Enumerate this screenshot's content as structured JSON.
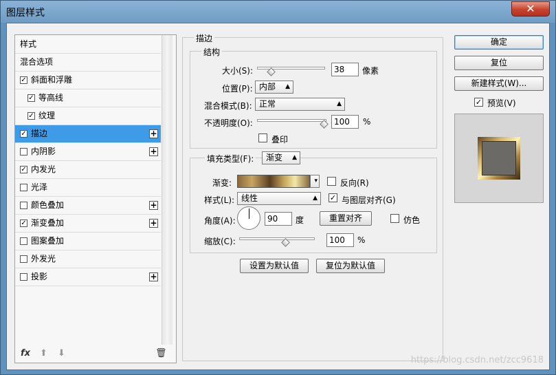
{
  "window": {
    "title": "图层样式",
    "close_glyph": "✕"
  },
  "styles": [
    {
      "label": "样式",
      "check": false,
      "plus": false,
      "indent": 0,
      "sel": false,
      "hascb": false
    },
    {
      "label": "混合选项",
      "check": false,
      "plus": false,
      "indent": 0,
      "sel": false,
      "hascb": false
    },
    {
      "label": "斜面和浮雕",
      "check": true,
      "plus": false,
      "indent": 0,
      "sel": false,
      "hascb": true
    },
    {
      "label": "等高线",
      "check": true,
      "plus": false,
      "indent": 1,
      "sel": false,
      "hascb": true
    },
    {
      "label": "纹理",
      "check": true,
      "plus": false,
      "indent": 1,
      "sel": false,
      "hascb": true
    },
    {
      "label": "描边",
      "check": true,
      "plus": true,
      "indent": 0,
      "sel": true,
      "hascb": true
    },
    {
      "label": "内阴影",
      "check": false,
      "plus": true,
      "indent": 0,
      "sel": false,
      "hascb": true
    },
    {
      "label": "内发光",
      "check": true,
      "plus": false,
      "indent": 0,
      "sel": false,
      "hascb": true
    },
    {
      "label": "光泽",
      "check": false,
      "plus": false,
      "indent": 0,
      "sel": false,
      "hascb": true
    },
    {
      "label": "颜色叠加",
      "check": false,
      "plus": true,
      "indent": 0,
      "sel": false,
      "hascb": true
    },
    {
      "label": "渐变叠加",
      "check": true,
      "plus": true,
      "indent": 0,
      "sel": false,
      "hascb": true
    },
    {
      "label": "图案叠加",
      "check": false,
      "plus": false,
      "indent": 0,
      "sel": false,
      "hascb": true
    },
    {
      "label": "外发光",
      "check": false,
      "plus": false,
      "indent": 0,
      "sel": false,
      "hascb": true
    },
    {
      "label": "投影",
      "check": false,
      "plus": true,
      "indent": 0,
      "sel": false,
      "hascb": true
    }
  ],
  "tools": {
    "fx": "fx",
    "up": "⬆",
    "down": "⬇",
    "trash": "🗑"
  },
  "stroke": {
    "title": "描边",
    "structure_title": "结构",
    "size_label": "大小(S):",
    "size_value": "38",
    "size_unit": "像素",
    "position_label": "位置(P):",
    "position_value": "内部",
    "blend_label": "混合模式(B):",
    "blend_value": "正常",
    "opacity_label": "不透明度(O):",
    "opacity_value": "100",
    "opacity_unit": "%",
    "overprint_label": "叠印",
    "fill_type_label": "填充类型(F):",
    "fill_type_value": "渐变",
    "gradient_label": "渐变:",
    "reverse_label": "反向(R)",
    "style_label": "样式(L):",
    "style_value": "线性",
    "align_label": "与图层对齐(G)",
    "angle_label": "角度(A):",
    "angle_value": "90",
    "angle_unit": "度",
    "reset_align": "重置对齐",
    "dither_label": "仿色",
    "scale_label": "缩放(C):",
    "scale_value": "100",
    "scale_unit": "%",
    "set_default": "设置为默认值",
    "reset_default": "复位为默认值"
  },
  "right": {
    "ok": "确定",
    "reset": "复位",
    "new_style": "新建样式(W)...",
    "preview_label": "预览(V)"
  },
  "watermark": "https://blog.csdn.net/zcc9618",
  "check_glyph": "✓",
  "arrow_glyph": "▲▼",
  "dropdown_glyph": "▾"
}
